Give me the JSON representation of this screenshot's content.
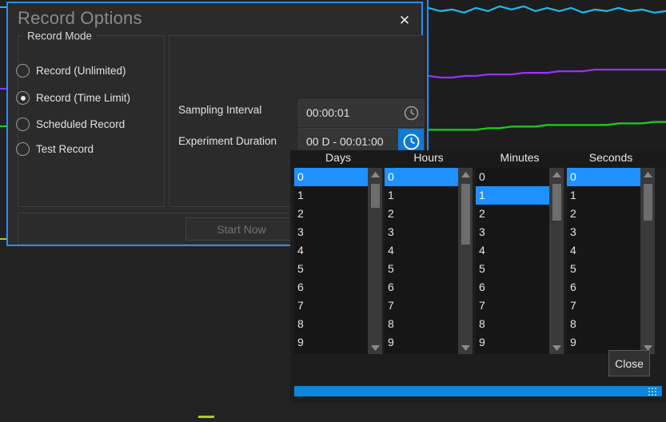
{
  "dialog": {
    "title": "Record Options",
    "close_icon": "close-x-icon",
    "group": {
      "legend": "Record Mode",
      "options": [
        {
          "label": "Record (Unlimited)",
          "selected": false
        },
        {
          "label": "Record (Time Limit)",
          "selected": true
        },
        {
          "label": "Scheduled Record",
          "selected": false
        },
        {
          "label": "Test Record",
          "selected": false
        }
      ]
    },
    "fields": [
      {
        "label": "Sampling Interval",
        "value": "00:00:01",
        "icon": "clock-icon",
        "icon_active": false
      },
      {
        "label": "Experiment Duration",
        "value": "00 D - 00:01:00",
        "icon": "clock-icon",
        "icon_active": true
      }
    ],
    "footer": {
      "start_label": "Start Now",
      "start_enabled": false
    }
  },
  "picker": {
    "columns": [
      {
        "header": "Days",
        "options": [
          "0",
          "1",
          "2",
          "3",
          "4",
          "5",
          "6",
          "7",
          "8",
          "9"
        ],
        "selected_index": 0,
        "scrollbar": {
          "thumb_top": 20,
          "thumb_height": 30
        }
      },
      {
        "header": "Hours",
        "options": [
          "0",
          "1",
          "2",
          "3",
          "4",
          "5",
          "6",
          "7",
          "8",
          "9"
        ],
        "selected_index": 0,
        "scrollbar": {
          "thumb_top": 20,
          "thumb_height": 76
        }
      },
      {
        "header": "Minutes",
        "options": [
          "0",
          "1",
          "2",
          "3",
          "4",
          "5",
          "6",
          "7",
          "8",
          "9"
        ],
        "selected_index": 1,
        "scrollbar": {
          "thumb_top": 20,
          "thumb_height": 46
        }
      },
      {
        "header": "Seconds",
        "options": [
          "0",
          "1",
          "2",
          "3",
          "4",
          "5",
          "6",
          "7",
          "8",
          "9"
        ],
        "selected_index": 0,
        "scrollbar": {
          "thumb_top": 20,
          "thumb_height": 46
        }
      }
    ],
    "close_label": "Close",
    "up_arrow_icon": "chevron-up-icon",
    "down_arrow_icon": "chevron-down-icon",
    "resize_grip_icon": "resize-grip-icon"
  },
  "colors": {
    "accent": "#1e90ff",
    "selection": "#1e90ff",
    "resize_bar": "#0d85d8",
    "window_bg": "#222222",
    "dialog_bg": "#2b2b2b",
    "picker_bg": "#1d1d1d",
    "list_bg": "#161616",
    "series_cyan": "#22b8e8",
    "series_purple": "#9b30ff",
    "series_green": "#19d219",
    "series_yellow": "#b5c727"
  },
  "chart_data": {
    "type": "line",
    "title": "",
    "xlabel": "",
    "ylabel": "",
    "grid": false,
    "legend": "none",
    "x": [
      0,
      1,
      2,
      3,
      4,
      5,
      6,
      7,
      8,
      9,
      10,
      11,
      12,
      13,
      14,
      15,
      16,
      17,
      18,
      19,
      20
    ],
    "series": [
      {
        "name": "cyan-trace",
        "color": "#22b8e8",
        "values": [
          95,
          93,
          94,
          92,
          95,
          93,
          96,
          94,
          96,
          93,
          95,
          93,
          95,
          92,
          94,
          93,
          95,
          93,
          94,
          92,
          93
        ]
      },
      {
        "name": "purple-trace",
        "color": "#9b30ff",
        "values": [
          52,
          51,
          51,
          52,
          52,
          53,
          53,
          53,
          54,
          54,
          54,
          55,
          55,
          55,
          56,
          56,
          56,
          56,
          56,
          56,
          56
        ]
      },
      {
        "name": "green-trace",
        "color": "#19d219",
        "values": [
          18,
          18,
          18,
          18,
          18,
          19,
          19,
          20,
          20,
          20,
          21,
          21,
          21,
          21,
          21,
          21,
          22,
          22,
          22,
          23,
          23
        ]
      }
    ],
    "ylim": [
      0,
      100
    ],
    "xlim": [
      0,
      20
    ]
  }
}
